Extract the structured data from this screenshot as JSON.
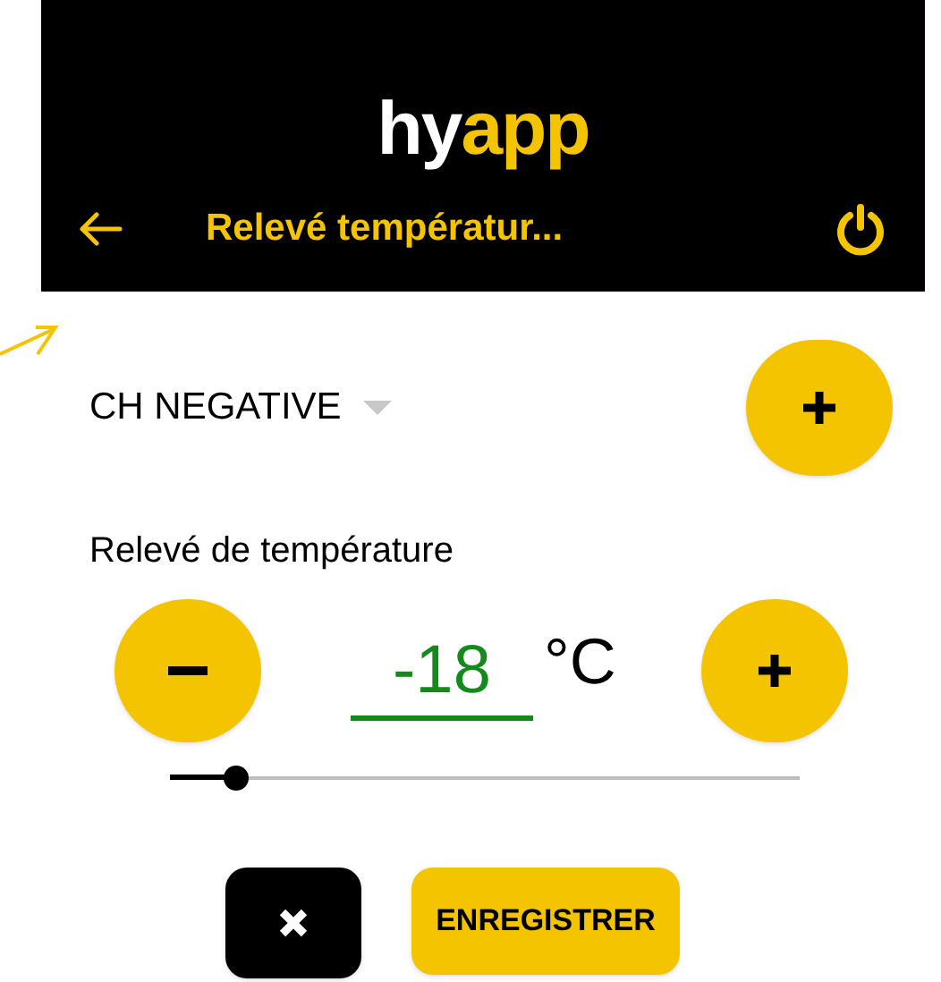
{
  "logo": {
    "parts": [
      {
        "text": "hy",
        "color": "#ffffff"
      },
      {
        "text": "app",
        "color": "#f5c400"
      }
    ]
  },
  "app_bar": {
    "title": "Relevé températur..."
  },
  "equipment": {
    "value": "CH NEGATIVE"
  },
  "reading": {
    "label": "Relevé de température",
    "value": "-18",
    "unit": "°C",
    "level": 0.105
  },
  "buttons": [
    {
      "kind": "cancel"
    },
    {
      "kind": "save",
      "label": "ENREGISTRER"
    }
  ]
}
